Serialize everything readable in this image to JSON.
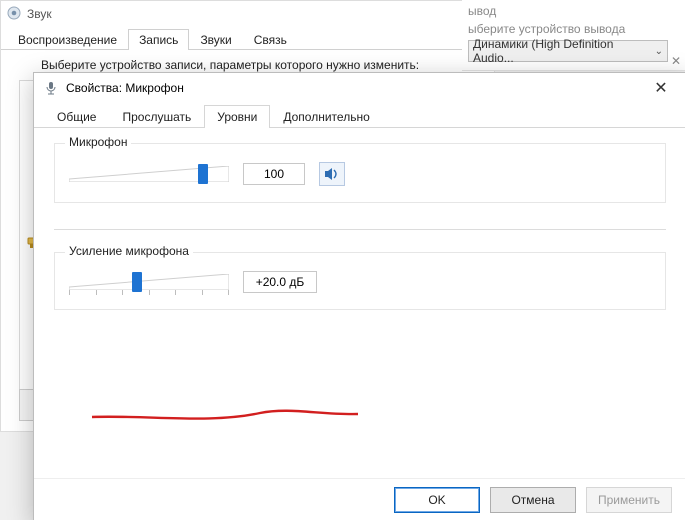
{
  "bg_sound": {
    "title": "Звук",
    "tabs": [
      "Воспроизведение",
      "Запись",
      "Звуки",
      "Связь"
    ],
    "active_tab_index": 1,
    "instruction": "Выберите устройство записи, параметры которого нужно изменить:"
  },
  "bg_output": {
    "header": "ывод",
    "subtitle": "ыберите устройство вывода",
    "selected": "Динамики (High Definition Audio..."
  },
  "props": {
    "title": "Свойства: Микрофон",
    "tabs": [
      "Общие",
      "Прослушать",
      "Уровни",
      "Дополнительно"
    ],
    "active_tab_index": 2,
    "mic": {
      "label": "Микрофон",
      "value": "100",
      "slider_percent": 86
    },
    "boost": {
      "label": "Усиление микрофона",
      "value": "+20.0 дБ",
      "slider_percent": 42
    },
    "buttons": {
      "ok": "OK",
      "cancel": "Отмена",
      "apply": "Применить"
    }
  }
}
